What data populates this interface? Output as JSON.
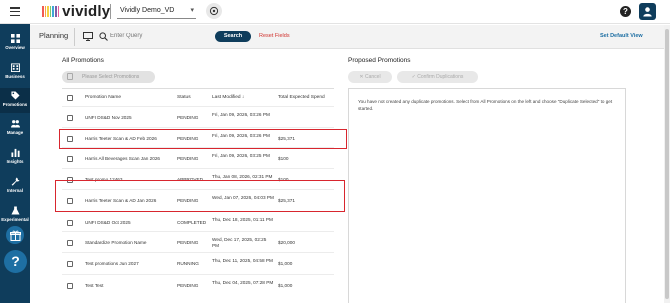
{
  "app": {
    "brand": "vividly",
    "env_select": "Vividly Demo_VD",
    "brand_colors": [
      "#f25c54",
      "#f7a541",
      "#f5d142",
      "#7bc96f",
      "#3fa7d6",
      "#7b5ea7",
      "#e85d9c"
    ],
    "primary_color": "#0f3d5c",
    "alert_color": "#d8262e"
  },
  "sidebar": {
    "items": [
      {
        "label": "Overview",
        "icon": "grid-icon"
      },
      {
        "label": "Business",
        "icon": "building-icon"
      },
      {
        "label": "Promotions",
        "icon": "tag-icon"
      },
      {
        "label": "Manage",
        "icon": "people-icon"
      },
      {
        "label": "Insights",
        "icon": "bar-chart-icon"
      },
      {
        "label": "Internal",
        "icon": "wrench-icon"
      },
      {
        "label": "Experimental",
        "icon": "flask-icon"
      }
    ],
    "help": "?"
  },
  "toolbar": {
    "title": "Planning",
    "query_placeholder": "Enter Query",
    "search_label": "Search",
    "reset_label": "Reset Fields",
    "default_view_label": "Set Default View"
  },
  "all_promotions": {
    "title": "All Promotions",
    "select_button": "Please Select Promotions",
    "columns": [
      "Promotion Name",
      "Status",
      "Last Modified",
      "Total Expected Spend"
    ],
    "rows": [
      {
        "name": "UNFI DS&D Nov 2025",
        "status": "PENDING",
        "modified": "Fri, Jan 09, 2026, 03:26 PM",
        "spend": ""
      },
      {
        "name": "Harris Teeter Scan & AD Feb 2026",
        "status": "PENDING",
        "modified": "Fri, Jan 09, 2026, 03:26 PM",
        "spend": "$25,371"
      },
      {
        "name": "Harris All Beverages Scan Jan 2026",
        "status": "PENDING",
        "modified": "Fri, Jan 09, 2026, 03:25 PM",
        "spend": "$100"
      },
      {
        "name": "Test promo 12463",
        "status": "APPROVED",
        "modified": "Thu, Jan 08, 2026, 02:31 PM",
        "spend": "$100"
      },
      {
        "name": "Harris Teeter Scan & AD Jan 2026",
        "status": "PENDING",
        "modified": "Wed, Jan 07, 2026, 04:03 PM",
        "spend": "$25,371"
      },
      {
        "name": "UNFI DS&D Oct 2025",
        "status": "COMPLETED",
        "modified": "Thu, Dec 18, 2025, 01:11 PM",
        "spend": ""
      },
      {
        "name": "Standardize Promotion Name",
        "status": "PENDING",
        "modified": "Wed, Dec 17, 2025, 02:25 PM",
        "spend": "$20,000"
      },
      {
        "name": "Test promotions Jun 2027",
        "status": "RUNNING",
        "modified": "Thu, Dec 11, 2025, 04:58 PM",
        "spend": "$1,000"
      },
      {
        "name": "Test Test",
        "status": "PENDING",
        "modified": "Thu, Dec 04, 2025, 07:28 PM",
        "spend": "$1,000"
      }
    ]
  },
  "proposed_promotions": {
    "title": "Proposed Promotions",
    "cancel_label": "Cancel",
    "confirm_label": "Confirm Duplications",
    "message": "You have not created any duplicate promotions. Select from All Promotions on the left and choose \"Duplicate Selected\" to get started."
  }
}
